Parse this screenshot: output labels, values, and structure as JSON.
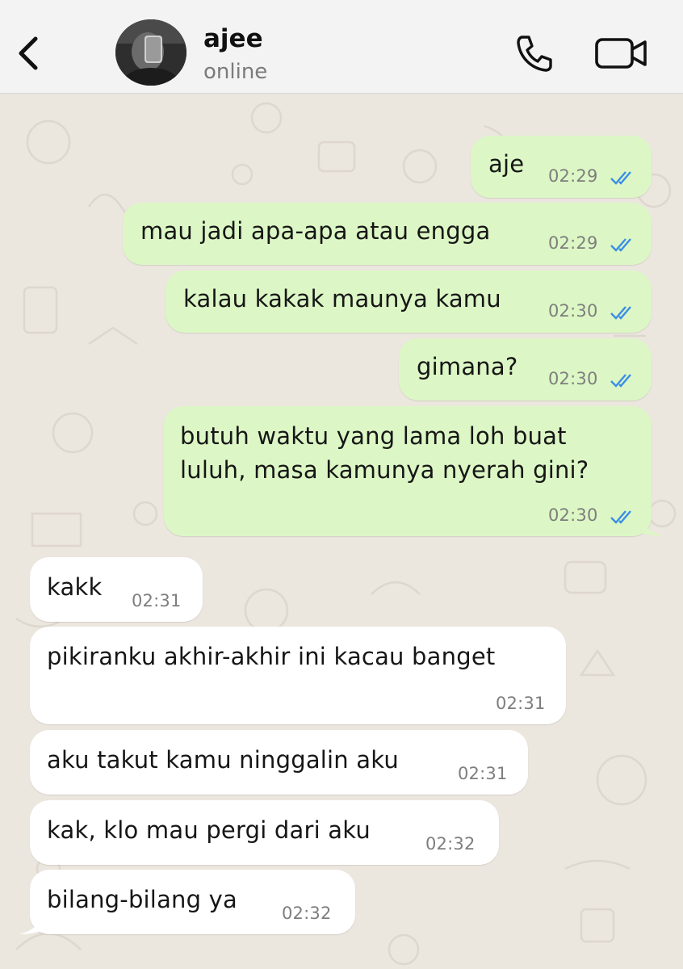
{
  "header": {
    "contact_name": "ajee",
    "status": "online"
  },
  "messages": [
    {
      "text": "aje",
      "time": "02:29",
      "direction": "outgoing",
      "read": true
    },
    {
      "text": "mau jadi apa-apa atau engga",
      "time": "02:29",
      "direction": "outgoing",
      "read": true
    },
    {
      "text": "kalau kakak maunya kamu",
      "time": "02:30",
      "direction": "outgoing",
      "read": true
    },
    {
      "text": "gimana?",
      "time": "02:30",
      "direction": "outgoing",
      "read": true
    },
    {
      "text_line1": "butuh waktu yang lama loh buat",
      "text_line2": "luluh, masa kamunya nyerah gini?",
      "time": "02:30",
      "direction": "outgoing",
      "read": true
    },
    {
      "text": "kakk",
      "time": "02:31",
      "direction": "incoming"
    },
    {
      "text": "pikiranku akhir-akhir ini kacau banget",
      "time": "02:31",
      "direction": "incoming"
    },
    {
      "text": "aku takut kamu ninggalin aku",
      "time": "02:31",
      "direction": "incoming"
    },
    {
      "text": "kak, klo mau pergi dari aku",
      "time": "02:32",
      "direction": "incoming"
    },
    {
      "text": "bilang-bilang ya",
      "time": "02:32",
      "direction": "incoming"
    }
  ],
  "colors": {
    "outgoing_bubble": "#dcf7c5",
    "incoming_bubble": "#ffffff",
    "read_ticks": "#3b8ee8",
    "wallpaper": "#ebe6de"
  },
  "icons": [
    "chevron-left-icon",
    "phone-icon",
    "video-camera-icon",
    "double-check-icon"
  ]
}
